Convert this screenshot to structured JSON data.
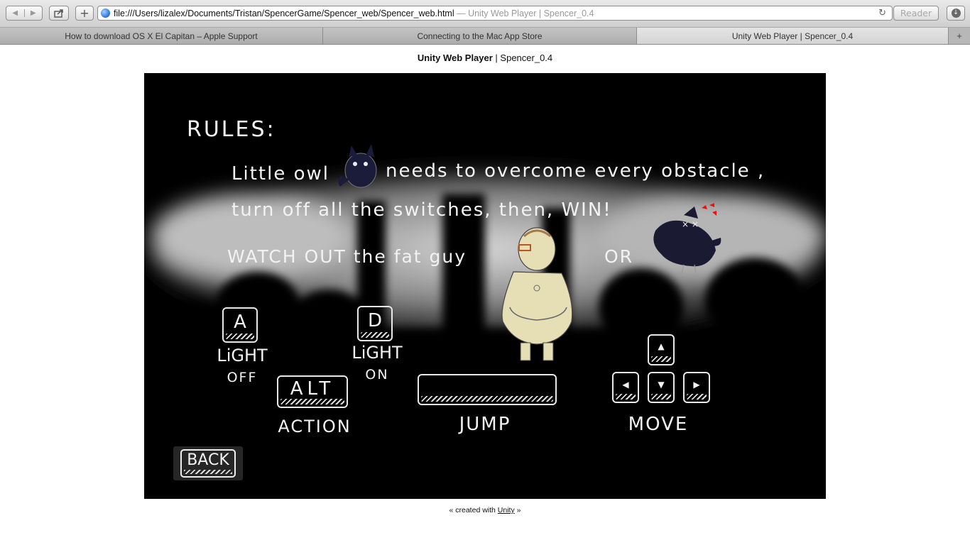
{
  "browser": {
    "url": "file:///Users/lizalex/Documents/Tristan/SpencerGame/Spencer_web/Spencer_web.html",
    "url_suffix": "— Unity Web Player | Spencer_0.4",
    "reader_label": "Reader",
    "tabs": [
      {
        "label": "How to download OS X El Capitan – Apple Support",
        "active": false
      },
      {
        "label": "Connecting to the Mac App Store",
        "active": false
      },
      {
        "label": "Unity Web Player | Spencer_0.4",
        "active": true
      }
    ],
    "new_tab_label": "+"
  },
  "page": {
    "heading_bold": "Unity Web Player",
    "heading_sep": " | ",
    "heading_rest": "Spencer_0.4",
    "footer_prefix": "« created with ",
    "footer_link": "Unity",
    "footer_suffix": " »"
  },
  "game": {
    "rules_title": "RULES:",
    "line1_a": "Little owl",
    "line1_b": "needs to overcome every obstacle ,",
    "line2": "turn off all the switches, then, WIN!",
    "line3": "WATCH OUT the fat guy",
    "line3_or": "OR",
    "keys": {
      "a": "A",
      "d": "D",
      "alt": "ALT",
      "up": "▲",
      "left": "◀",
      "down": "▼",
      "right": "▶"
    },
    "labels": {
      "light_off_1": "LiGHT",
      "light_off_2": "OFF",
      "light_on_1": "LiGHT",
      "light_on_2": "ON",
      "action": "ACTION",
      "jump": "JUMP",
      "move": "MOVE"
    },
    "back_label": "BACK"
  }
}
